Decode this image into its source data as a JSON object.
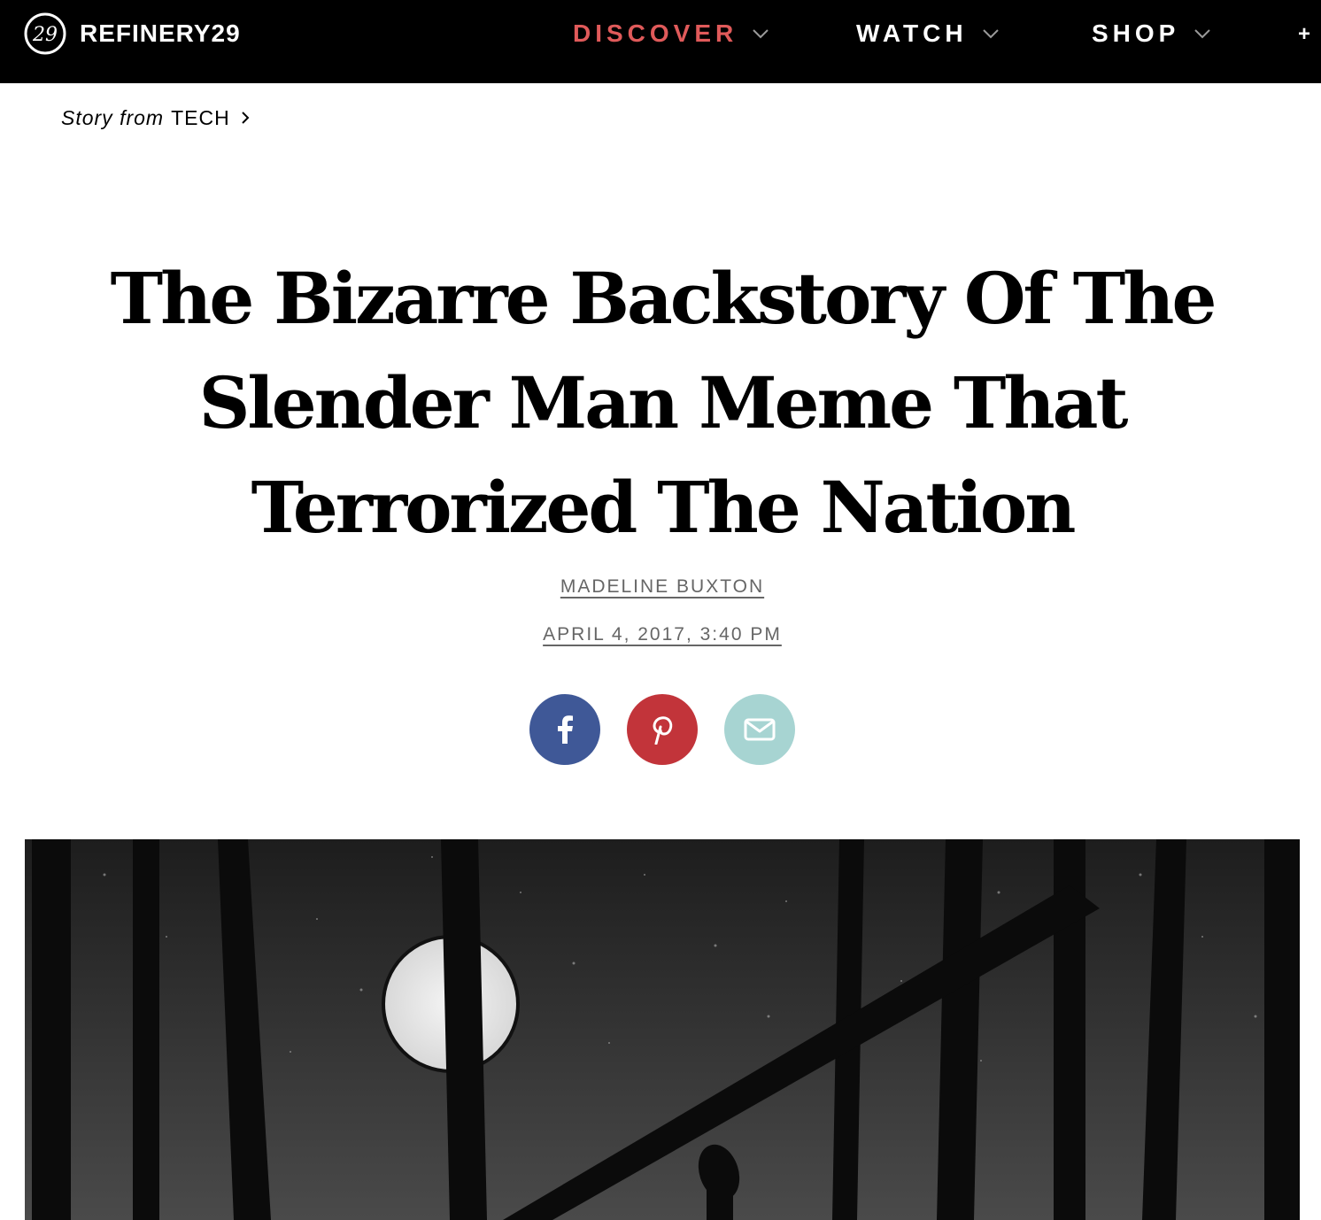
{
  "header": {
    "brand": "REFINERY29",
    "logo_mark_text": "29",
    "nav": [
      {
        "label": "DISCOVER",
        "active": true
      },
      {
        "label": "WATCH",
        "active": false
      },
      {
        "label": "SHOP",
        "active": false
      }
    ],
    "more_label": "+"
  },
  "breadcrumb": {
    "prefix": "Story from",
    "section": "TECH"
  },
  "article": {
    "title_lines": [
      "The Bizarre Backstory Of The",
      "Slender Man Meme That",
      "Terrorized The Nation"
    ],
    "author": "MADELINE BUXTON",
    "date": "APRIL 4, 2017, 3:40 PM"
  },
  "share": [
    {
      "name": "facebook",
      "icon": "facebook-icon",
      "color": "#3f5897"
    },
    {
      "name": "pinterest",
      "icon": "pinterest-icon",
      "color": "#c2343a"
    },
    {
      "name": "email",
      "icon": "mail-icon",
      "color": "#a7d4d2"
    }
  ],
  "colors": {
    "nav_background": "#000000",
    "nav_active": "#e05a5a",
    "byline": "#666666"
  },
  "hero": {
    "subject": "night forest illustration with moon and silhouetted trees"
  }
}
